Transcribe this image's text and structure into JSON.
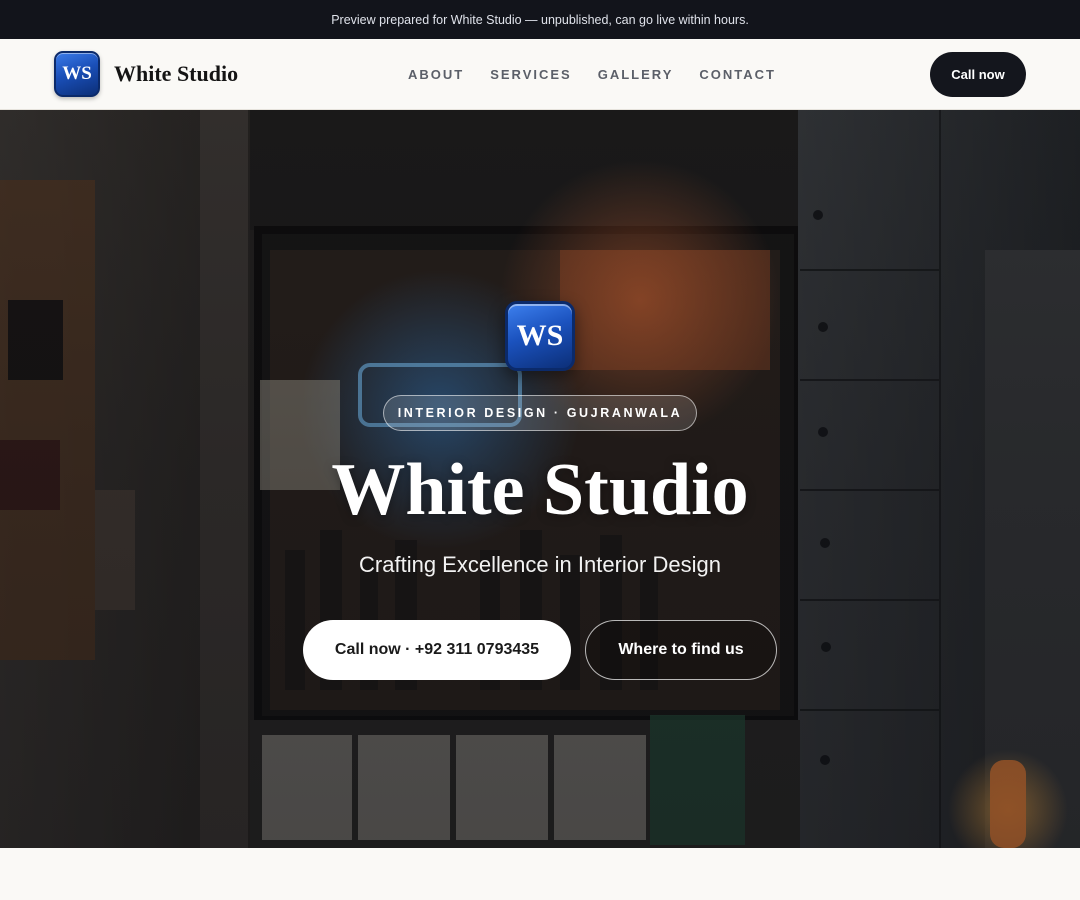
{
  "announcement": "Preview prepared for White Studio — unpublished, can go live within hours.",
  "brand": {
    "initials": "WS",
    "name": "White Studio"
  },
  "nav": {
    "items": [
      {
        "label": "ABOUT"
      },
      {
        "label": "SERVICES"
      },
      {
        "label": "GALLERY"
      },
      {
        "label": "CONTACT"
      }
    ],
    "cta_label": "Call now"
  },
  "hero": {
    "logo_initials": "WS",
    "tagline": "INTERIOR DESIGN · GUJRANWALA",
    "title": "White Studio",
    "subtitle": "Crafting Excellence in Interior Design",
    "primary_button": "Call now · +92 311 0793435",
    "secondary_button": "Where to find us"
  },
  "colors": {
    "announce_bg": "#12141b",
    "nav_bg": "#faf9f6",
    "cta_dark": "#14161d",
    "logo_blue": "#1a4fb8"
  }
}
